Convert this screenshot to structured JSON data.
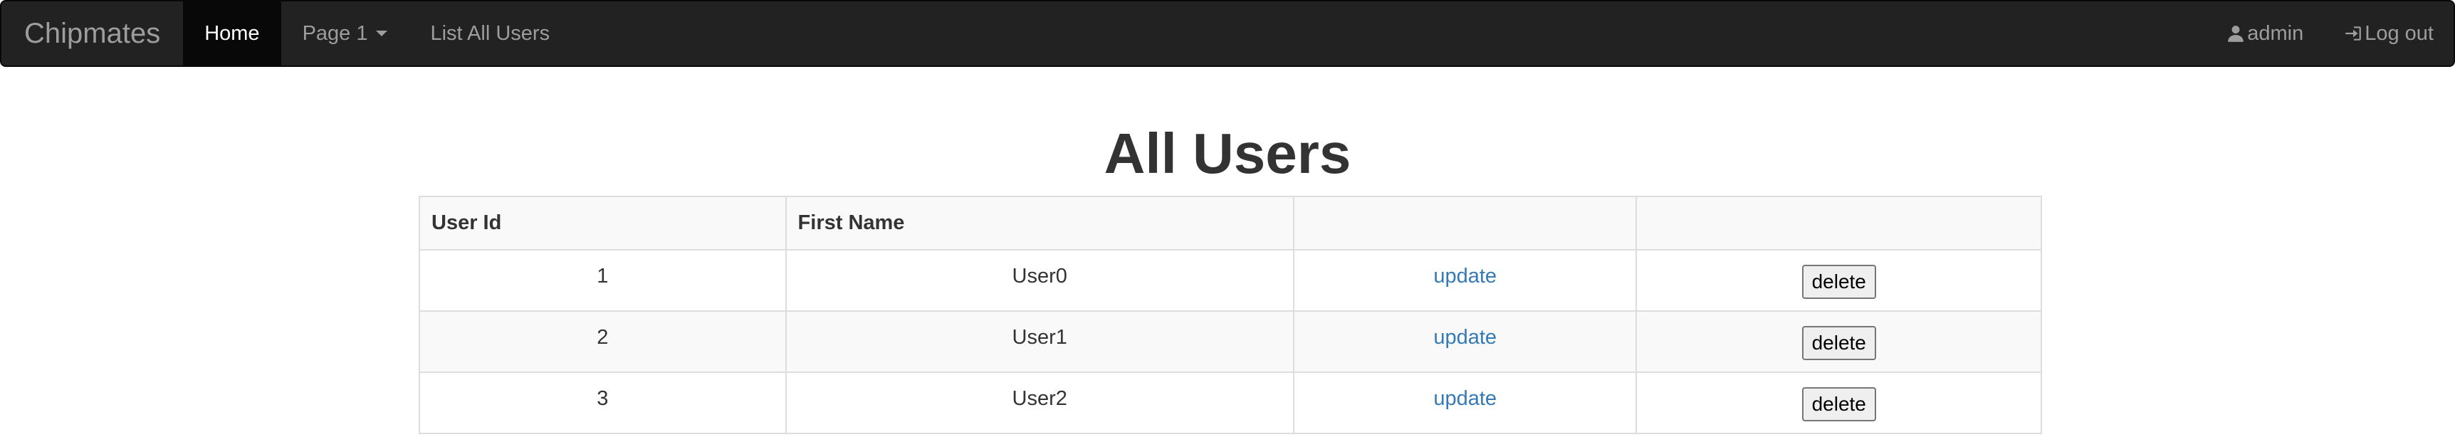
{
  "navbar": {
    "brand": "Chipmates",
    "items": [
      {
        "label": "Home",
        "active": true
      },
      {
        "label": "Page 1",
        "dropdown": true
      },
      {
        "label": "List All Users"
      }
    ],
    "right": [
      {
        "label": "admin",
        "icon": "user-icon"
      },
      {
        "label": "Log out",
        "icon": "log-in-icon"
      }
    ]
  },
  "page": {
    "title": "All Users"
  },
  "table": {
    "headers": [
      "User Id",
      "First Name",
      "",
      ""
    ],
    "rows": [
      {
        "id": "1",
        "first_name": "User0",
        "update": "update",
        "delete": "delete"
      },
      {
        "id": "2",
        "first_name": "User1",
        "update": "update",
        "delete": "delete"
      },
      {
        "id": "3",
        "first_name": "User2",
        "update": "update",
        "delete": "delete"
      }
    ]
  },
  "colors": {
    "navbar_bg": "#222222",
    "navbar_active_bg": "#080808",
    "nav_text": "#9d9d9d",
    "link": "#337ab7"
  }
}
